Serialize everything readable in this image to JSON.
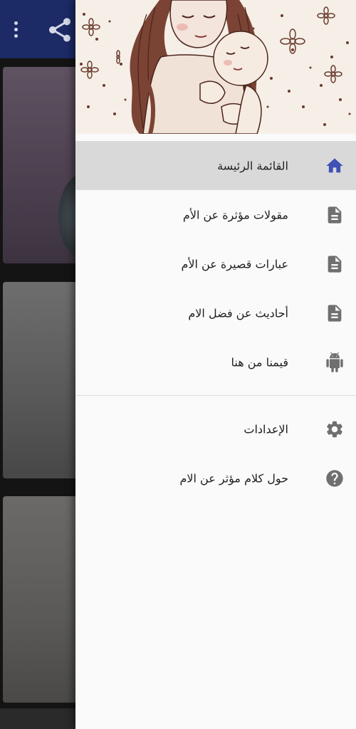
{
  "background": {
    "toolbar_icons": {
      "more": "more-vert-icon",
      "share": "share-icon"
    },
    "toolbar_color": "#1c2a66"
  },
  "drawer": {
    "header_image": "mother-holding-baby-sketch",
    "accent_color": "#3f51b5",
    "icon_color": "#6f6f6f",
    "items": [
      {
        "label": "القائمة الرئيسة",
        "icon": "home-icon",
        "active": true
      },
      {
        "label": "مقولات مؤثرة عن الأم",
        "icon": "document-icon",
        "active": false
      },
      {
        "label": "عبارات قصيرة عن الأم",
        "icon": "document-icon",
        "active": false
      },
      {
        "label": "أحاديث عن فضل الام",
        "icon": "document-icon",
        "active": false
      },
      {
        "label": "قيمنا من هنا",
        "icon": "android-icon",
        "active": false
      }
    ],
    "secondary_items": [
      {
        "label": "الإعدادات",
        "icon": "settings-icon"
      },
      {
        "label": "حول كلام مؤثر عن الام",
        "icon": "help-icon"
      }
    ]
  }
}
